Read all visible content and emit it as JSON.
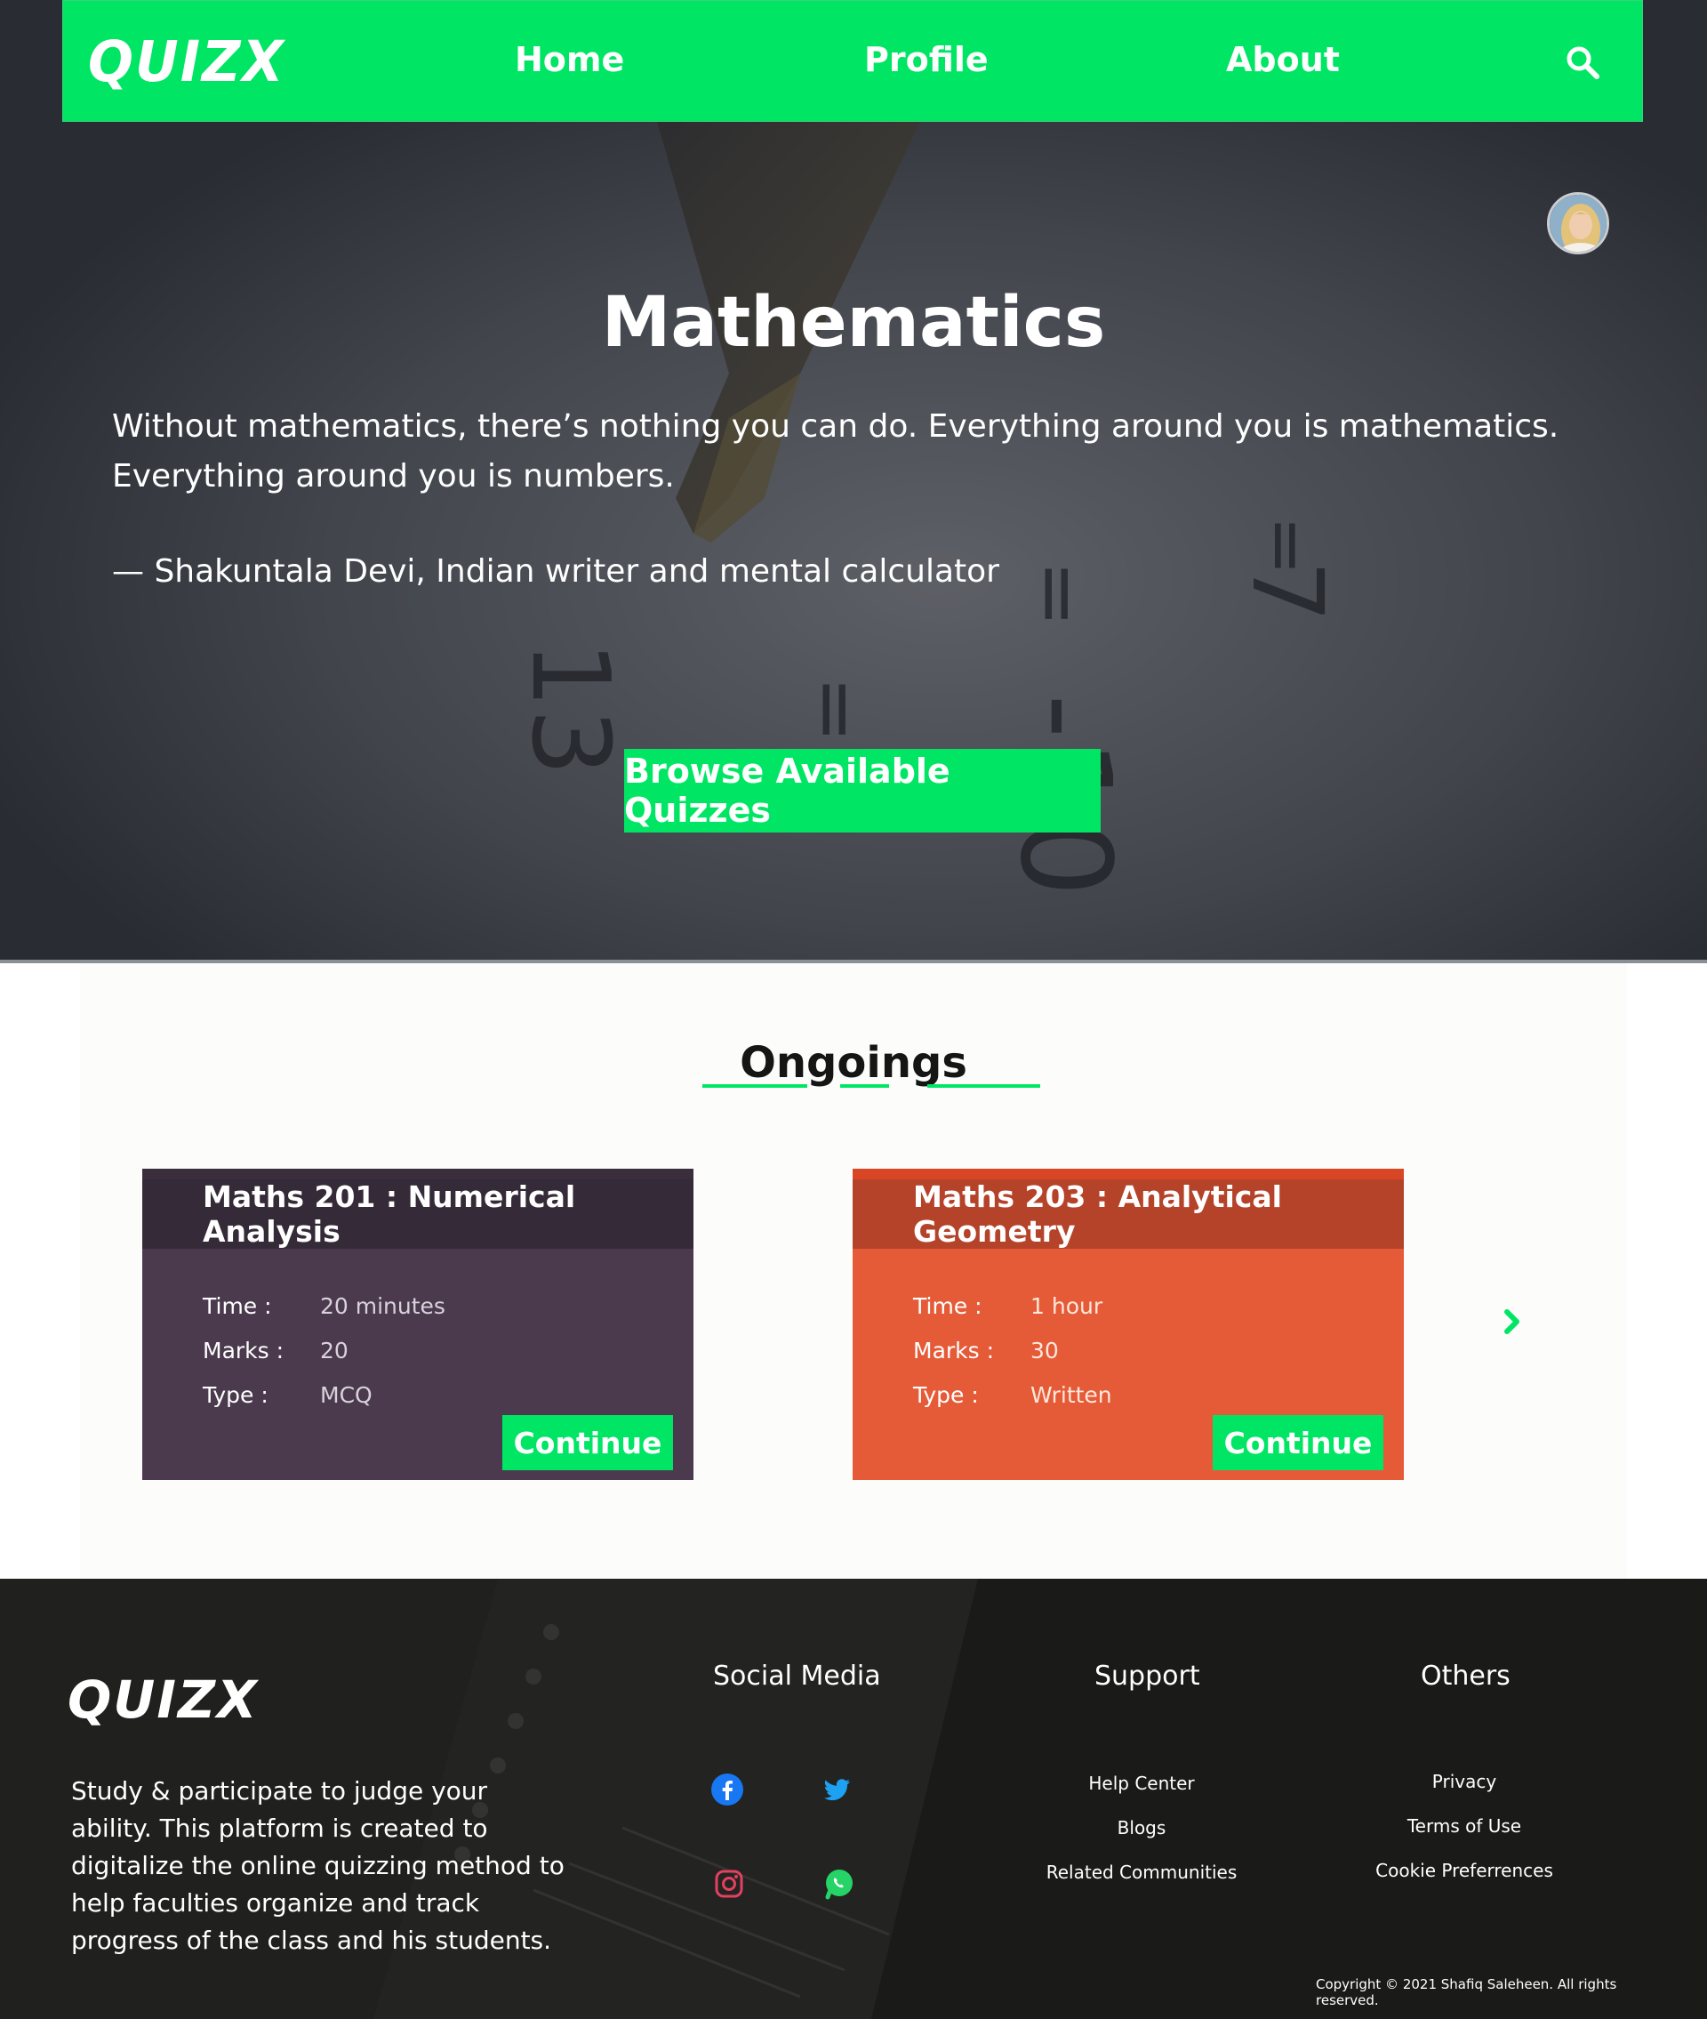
{
  "nav": {
    "logo": "QUIZX",
    "home": "Home",
    "profile": "Profile",
    "about": "About",
    "search_icon": "search-icon"
  },
  "hero": {
    "title": "Mathematics",
    "quote": "Without mathematics, there’s nothing you can do. Everything around you is mathematics. Everything around you is numbers.",
    "author": "— Shakuntala Devi, Indian writer and mental calculator",
    "button": "Browse Available Quizzes",
    "background_numbers": [
      "13",
      "=",
      "-10",
      "7"
    ]
  },
  "ongoings": {
    "title": "Ongoings",
    "labels": {
      "time": "Time :",
      "marks": "Marks :",
      "type": "Type :"
    },
    "cards": [
      {
        "title": "Maths 201 : Numerical Analysis",
        "time": "20 minutes",
        "marks": "20",
        "type": "MCQ",
        "button": "Continue",
        "color": "#4b3a4e"
      },
      {
        "title": "Maths 203 : Analytical Geometry",
        "time": "1 hour",
        "marks": "30",
        "type": "Written",
        "button": "Continue",
        "color": "#e55b37"
      }
    ]
  },
  "footer": {
    "logo": "QUIZX",
    "description": "Study & participate to judge your ability. This platform is created to digitalize the online quizzing method to help faculties organize and track progress of the class and his students.",
    "social_title": "Social Media",
    "support_title": "Support",
    "others_title": "Others",
    "support_links": [
      "Help Center",
      "Blogs",
      "Related Communities"
    ],
    "others_links": [
      "Privacy",
      "Terms of Use",
      "Cookie Preferrences"
    ],
    "copyright": "Copyright © 2021 Shafiq Saleheen. All rights reserved."
  },
  "colors": {
    "accent": "#00e664",
    "card_purple": "#4b3a4e",
    "card_orange": "#e55b37"
  }
}
